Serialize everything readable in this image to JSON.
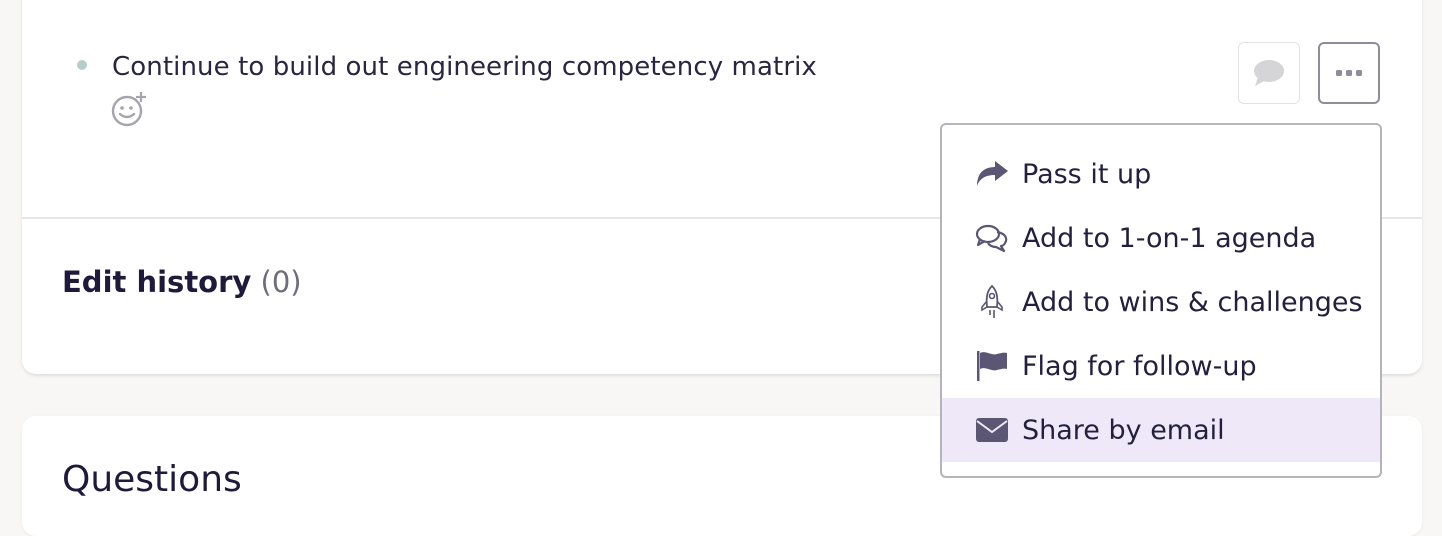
{
  "action_item": {
    "text": "Continue to build out engineering competency matrix",
    "emoji_icon": "smiley-add-icon",
    "comment_icon": "speech-bubble-icon",
    "more_icon": "ellipsis-icon"
  },
  "edit_history": {
    "label": "Edit history",
    "count": "(0)"
  },
  "questions_card": {
    "title": "Questions"
  },
  "menu": {
    "items": [
      {
        "label": "Pass it up",
        "icon": "share-forward-icon"
      },
      {
        "label": "Add to 1-on-1 agenda",
        "icon": "chat-bubbles-icon"
      },
      {
        "label": "Add to wins & challenges",
        "icon": "rocket-icon"
      },
      {
        "label": "Flag for follow-up",
        "icon": "flag-icon"
      },
      {
        "label": "Share by email",
        "icon": "envelope-icon",
        "highlighted": true
      }
    ]
  },
  "colors": {
    "icon": "#5b5673",
    "highlight": "#efe8f8",
    "bullet": "#b7cdc9"
  }
}
